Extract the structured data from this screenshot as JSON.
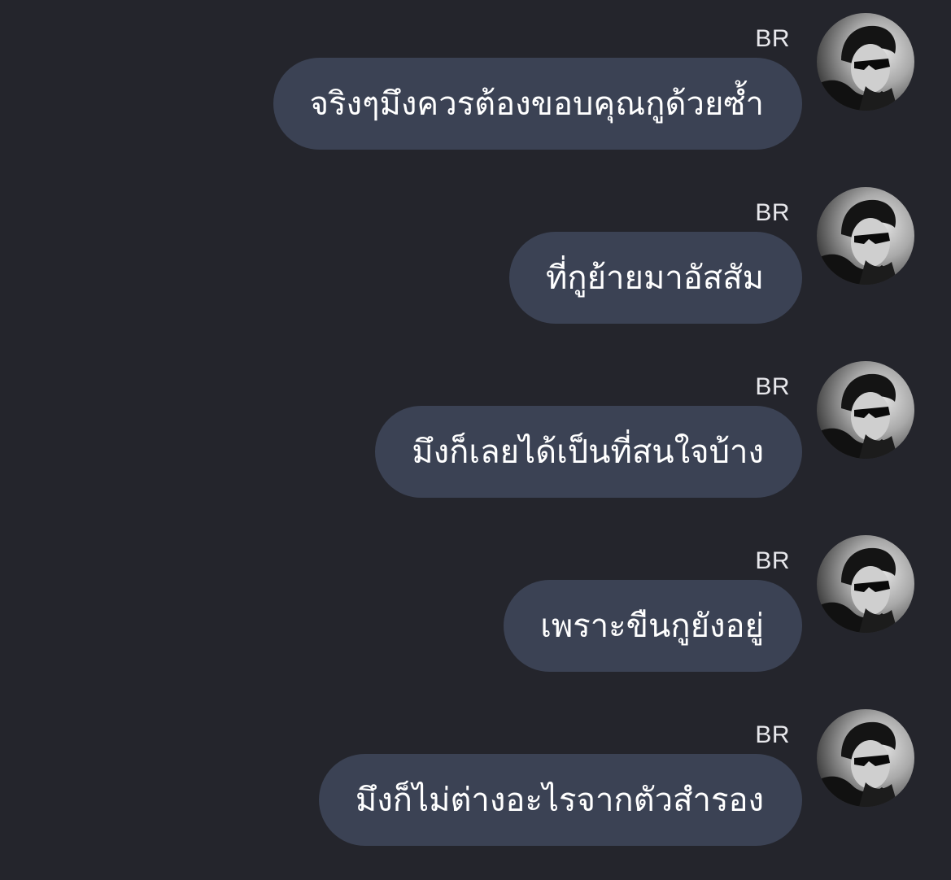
{
  "colors": {
    "background": "#24252c",
    "bubble": "#3b4254",
    "text": "#ffffff",
    "sender": "#e8e8ec"
  },
  "messages": [
    {
      "sender": "BR",
      "avatar_icon": "profile-photo",
      "text": "จริงๆมึงควรต้องขอบคุณกูด้วยซ้ำ"
    },
    {
      "sender": "BR",
      "avatar_icon": "profile-photo",
      "text": "ที่กูย้ายมาอัสสัม"
    },
    {
      "sender": "BR",
      "avatar_icon": "profile-photo",
      "text": "มึงก็เลยได้เป็นที่สนใจบ้าง"
    },
    {
      "sender": "BR",
      "avatar_icon": "profile-photo",
      "text": "เพราะขืนกูยังอยู่"
    },
    {
      "sender": "BR",
      "avatar_icon": "profile-photo",
      "text": "มึงก็ไม่ต่างอะไรจากตัวสำรอง"
    }
  ]
}
